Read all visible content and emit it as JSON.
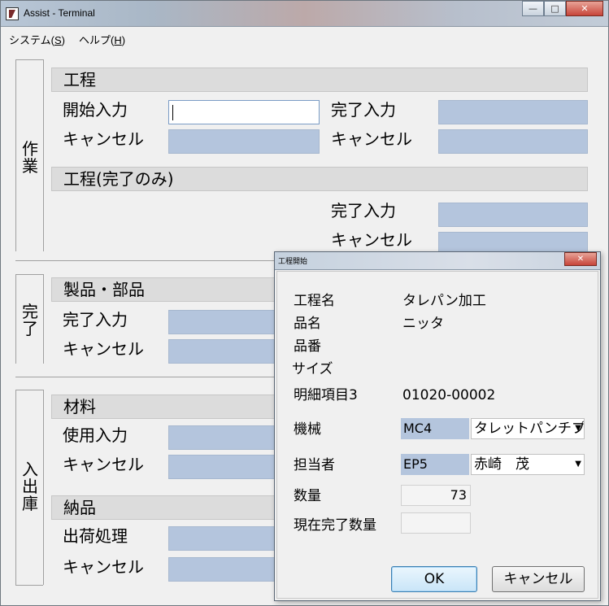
{
  "window": {
    "title": "Assist - Terminal"
  },
  "menu": {
    "system": {
      "label": "システム(",
      "accel": "S",
      "suffix": ")"
    },
    "help": {
      "label": "ヘルプ(",
      "accel": "H",
      "suffix": ")"
    }
  },
  "work_group": {
    "label": "作\n業",
    "process": {
      "header": "工程",
      "start_input": "開始入力",
      "complete_input": "完了入力",
      "cancel_left": "キャンセル",
      "cancel_right": "キャンセル"
    },
    "process_complete_only": {
      "header": "工程(完了のみ)",
      "complete_input": "完了入力",
      "cancel": "キャンセル"
    }
  },
  "complete_group": {
    "label": "完\n了",
    "product": {
      "header": "製品・部品",
      "complete_input": "完了入力",
      "cancel": "キャンセル"
    }
  },
  "stock_group": {
    "label": "入\n出\n庫",
    "material": {
      "header": "材料",
      "use_input": "使用入力",
      "cancel": "キャンセル"
    },
    "delivery": {
      "header": "納品",
      "shipping": "出荷処理",
      "cancel": "キャンセル"
    }
  },
  "dialog": {
    "title": "工程開始",
    "rows": {
      "process_name_label": "工程名",
      "process_name_value": "タレパン加工",
      "item_name_label": "品名",
      "item_name_value": "ニッタ",
      "item_no_label": "品番",
      "size_label": "サイズ",
      "detail3_label": "明細項目3",
      "detail3_value": "01020-00002",
      "machine_label": "機械",
      "machine_code": "MC4",
      "machine_name": "タレットパンチプ",
      "person_label": "担当者",
      "person_code": "EP5",
      "person_name": "赤崎　茂",
      "qty_label": "数量",
      "qty_value": "73",
      "current_qty_label": "現在完了数量",
      "current_qty_value": ""
    },
    "ok_label": "OK",
    "cancel_label": "キャンセル"
  }
}
